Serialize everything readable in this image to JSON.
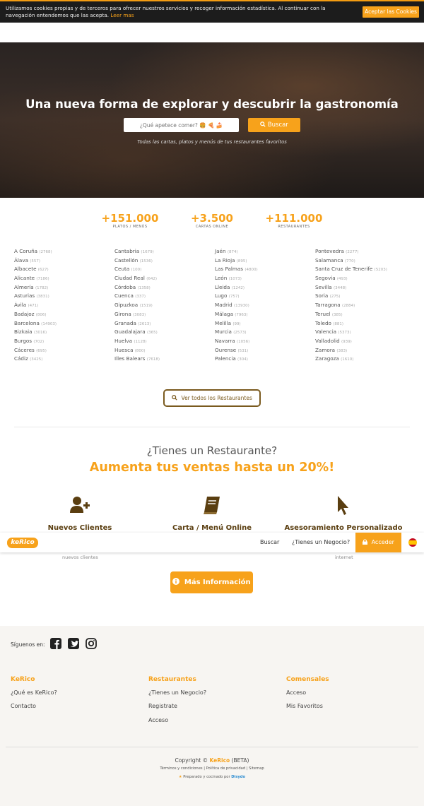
{
  "cookie": {
    "text": "Utilizamos cookies propias y de terceros para ofrecer nuestros servicios y recoger información estadística. Al continuar con la navegación entendemos que las acepta.",
    "link": "Leer mas",
    "accept": "Aceptar las Cookies"
  },
  "hero": {
    "title": "Una nueva forma de explorar y descubrir la gastronomía",
    "placeholder": "¿Qué apetece comer? 🍔 🍕 🍰",
    "search_label": "Buscar",
    "subtitle": "Todas las cartas, platos y menús de tus restaurantes favoritos"
  },
  "stats": [
    {
      "value": "+151.000",
      "label": "PLATOS / MENÚS"
    },
    {
      "value": "+3.500",
      "label": "CARTAS ONLINE"
    },
    {
      "value": "+111.000",
      "label": "RESTAURANTES"
    }
  ],
  "provinces": [
    [
      {
        "name": "A Coruña",
        "count": "(2768)"
      },
      {
        "name": "Álava",
        "count": "(557)"
      },
      {
        "name": "Albacete",
        "count": "(627)"
      },
      {
        "name": "Alicante",
        "count": "(7186)"
      },
      {
        "name": "Almería",
        "count": "(1782)"
      },
      {
        "name": "Asturias",
        "count": "(3831)"
      },
      {
        "name": "Ávila",
        "count": "(471)"
      },
      {
        "name": "Badajoz",
        "count": "(806)"
      },
      {
        "name": "Barcelona",
        "count": "(14903)"
      },
      {
        "name": "Bizkaia",
        "count": "(3016)"
      },
      {
        "name": "Burgos",
        "count": "(702)"
      },
      {
        "name": "Cáceres",
        "count": "(695)"
      },
      {
        "name": "Cádiz",
        "count": "(3425)"
      }
    ],
    [
      {
        "name": "Cantabria",
        "count": "(1679)"
      },
      {
        "name": "Castellón",
        "count": "(1536)"
      },
      {
        "name": "Ceuta",
        "count": "(100)"
      },
      {
        "name": "Ciudad Real",
        "count": "(642)"
      },
      {
        "name": "Córdoba",
        "count": "(1358)"
      },
      {
        "name": "Cuenca",
        "count": "(337)"
      },
      {
        "name": "Gipuzkoa",
        "count": "(1519)"
      },
      {
        "name": "Girona",
        "count": "(3083)"
      },
      {
        "name": "Granada",
        "count": "(2613)"
      },
      {
        "name": "Guadalajara",
        "count": "(365)"
      },
      {
        "name": "Huelva",
        "count": "(1128)"
      },
      {
        "name": "Huesca",
        "count": "(800)"
      },
      {
        "name": "Illes Balears",
        "count": "(7618)"
      }
    ],
    [
      {
        "name": "Jaén",
        "count": "(874)"
      },
      {
        "name": "La Rioja",
        "count": "(895)"
      },
      {
        "name": "Las Palmas",
        "count": "(4800)"
      },
      {
        "name": "León",
        "count": "(1073)"
      },
      {
        "name": "Lleida",
        "count": "(1242)"
      },
      {
        "name": "Lugo",
        "count": "(757)"
      },
      {
        "name": "Madrid",
        "count": "(13930)"
      },
      {
        "name": "Málaga",
        "count": "(7963)"
      },
      {
        "name": "Melilla",
        "count": "(99)"
      },
      {
        "name": "Murcia",
        "count": "(2573)"
      },
      {
        "name": "Navarra",
        "count": "(1056)"
      },
      {
        "name": "Ourense",
        "count": "(531)"
      },
      {
        "name": "Palencia",
        "count": "(304)"
      }
    ],
    [
      {
        "name": "Pontevedra",
        "count": "(2277)"
      },
      {
        "name": "Salamanca",
        "count": "(770)"
      },
      {
        "name": "Santa Cruz de Tenerife",
        "count": "(5203)"
      },
      {
        "name": "Segovia",
        "count": "(493)"
      },
      {
        "name": "Sevilla",
        "count": "(3448)"
      },
      {
        "name": "Soria",
        "count": "(275)"
      },
      {
        "name": "Tarragona",
        "count": "(2884)"
      },
      {
        "name": "Teruel",
        "count": "(385)"
      },
      {
        "name": "Toledo",
        "count": "(881)"
      },
      {
        "name": "Valencia",
        "count": "(5373)"
      },
      {
        "name": "Valladolid",
        "count": "(939)"
      },
      {
        "name": "Zamora",
        "count": "(383)"
      },
      {
        "name": "Zaragoza",
        "count": "(1610)"
      }
    ]
  ],
  "all_restaurants": "Ver todos los Restaurantes",
  "promo": {
    "question": "¿Tienes un Restaurante?",
    "headline": "Aumenta tus ventas hasta un 20%!",
    "features": [
      {
        "title": "Nuevos Clientes",
        "icon": "user-plus-icon",
        "desc": "nuevos clientes"
      },
      {
        "title": "Carta / Menú Online",
        "icon": "book-icon",
        "desc": ""
      },
      {
        "title": "Asesoramiento Personalizado",
        "icon": "cursor-icon",
        "desc": "internet"
      }
    ],
    "more_info": "Más Información"
  },
  "nav": {
    "logo": "keRico",
    "search": "Buscar",
    "business": "¿Tienes un Negocio?",
    "login": "Acceder"
  },
  "footer": {
    "follow": "Síguenos en:",
    "cols": [
      {
        "head": "KeRico",
        "links": [
          "¿Qué es KeRico?",
          "Contacto"
        ]
      },
      {
        "head": "Restaurantes",
        "links": [
          "¿Tienes un Negocio?",
          "Registrate",
          "Acceso"
        ]
      },
      {
        "head": "Comensales",
        "links": [
          "Acceso",
          "Mis Favoritos"
        ]
      }
    ],
    "copyright_prefix": "Copyright ©",
    "copyright_brand": "KeRico",
    "copyright_suffix": "(BETA)",
    "legal": "Términos y condiciones | Política de privacidad | Sitemap",
    "cooked_prefix": "Preparado y cocinado por",
    "cooked_brand": "Disydo"
  },
  "colors": {
    "accent": "#f7a21b",
    "brown": "#5a3e10"
  }
}
